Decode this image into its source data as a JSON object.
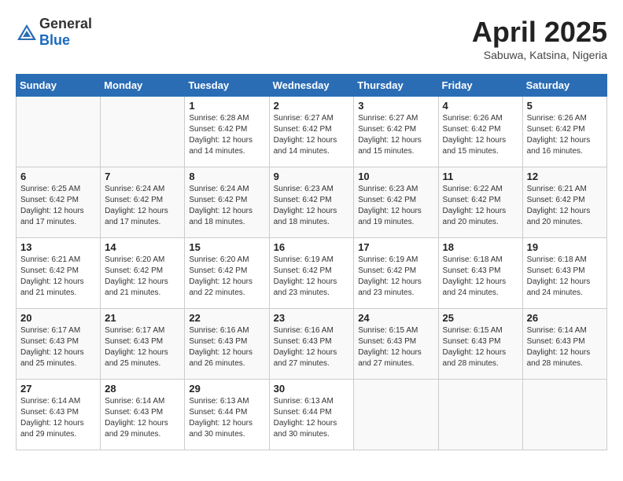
{
  "header": {
    "logo_general": "General",
    "logo_blue": "Blue",
    "month_title": "April 2025",
    "subtitle": "Sabuwa, Katsina, Nigeria"
  },
  "days_of_week": [
    "Sunday",
    "Monday",
    "Tuesday",
    "Wednesday",
    "Thursday",
    "Friday",
    "Saturday"
  ],
  "weeks": [
    [
      {
        "day": "",
        "sunrise": "",
        "sunset": "",
        "daylight": ""
      },
      {
        "day": "",
        "sunrise": "",
        "sunset": "",
        "daylight": ""
      },
      {
        "day": "1",
        "sunrise": "Sunrise: 6:28 AM",
        "sunset": "Sunset: 6:42 PM",
        "daylight": "Daylight: 12 hours and 14 minutes."
      },
      {
        "day": "2",
        "sunrise": "Sunrise: 6:27 AM",
        "sunset": "Sunset: 6:42 PM",
        "daylight": "Daylight: 12 hours and 14 minutes."
      },
      {
        "day": "3",
        "sunrise": "Sunrise: 6:27 AM",
        "sunset": "Sunset: 6:42 PM",
        "daylight": "Daylight: 12 hours and 15 minutes."
      },
      {
        "day": "4",
        "sunrise": "Sunrise: 6:26 AM",
        "sunset": "Sunset: 6:42 PM",
        "daylight": "Daylight: 12 hours and 15 minutes."
      },
      {
        "day": "5",
        "sunrise": "Sunrise: 6:26 AM",
        "sunset": "Sunset: 6:42 PM",
        "daylight": "Daylight: 12 hours and 16 minutes."
      }
    ],
    [
      {
        "day": "6",
        "sunrise": "Sunrise: 6:25 AM",
        "sunset": "Sunset: 6:42 PM",
        "daylight": "Daylight: 12 hours and 17 minutes."
      },
      {
        "day": "7",
        "sunrise": "Sunrise: 6:24 AM",
        "sunset": "Sunset: 6:42 PM",
        "daylight": "Daylight: 12 hours and 17 minutes."
      },
      {
        "day": "8",
        "sunrise": "Sunrise: 6:24 AM",
        "sunset": "Sunset: 6:42 PM",
        "daylight": "Daylight: 12 hours and 18 minutes."
      },
      {
        "day": "9",
        "sunrise": "Sunrise: 6:23 AM",
        "sunset": "Sunset: 6:42 PM",
        "daylight": "Daylight: 12 hours and 18 minutes."
      },
      {
        "day": "10",
        "sunrise": "Sunrise: 6:23 AM",
        "sunset": "Sunset: 6:42 PM",
        "daylight": "Daylight: 12 hours and 19 minutes."
      },
      {
        "day": "11",
        "sunrise": "Sunrise: 6:22 AM",
        "sunset": "Sunset: 6:42 PM",
        "daylight": "Daylight: 12 hours and 20 minutes."
      },
      {
        "day": "12",
        "sunrise": "Sunrise: 6:21 AM",
        "sunset": "Sunset: 6:42 PM",
        "daylight": "Daylight: 12 hours and 20 minutes."
      }
    ],
    [
      {
        "day": "13",
        "sunrise": "Sunrise: 6:21 AM",
        "sunset": "Sunset: 6:42 PM",
        "daylight": "Daylight: 12 hours and 21 minutes."
      },
      {
        "day": "14",
        "sunrise": "Sunrise: 6:20 AM",
        "sunset": "Sunset: 6:42 PM",
        "daylight": "Daylight: 12 hours and 21 minutes."
      },
      {
        "day": "15",
        "sunrise": "Sunrise: 6:20 AM",
        "sunset": "Sunset: 6:42 PM",
        "daylight": "Daylight: 12 hours and 22 minutes."
      },
      {
        "day": "16",
        "sunrise": "Sunrise: 6:19 AM",
        "sunset": "Sunset: 6:42 PM",
        "daylight": "Daylight: 12 hours and 23 minutes."
      },
      {
        "day": "17",
        "sunrise": "Sunrise: 6:19 AM",
        "sunset": "Sunset: 6:42 PM",
        "daylight": "Daylight: 12 hours and 23 minutes."
      },
      {
        "day": "18",
        "sunrise": "Sunrise: 6:18 AM",
        "sunset": "Sunset: 6:43 PM",
        "daylight": "Daylight: 12 hours and 24 minutes."
      },
      {
        "day": "19",
        "sunrise": "Sunrise: 6:18 AM",
        "sunset": "Sunset: 6:43 PM",
        "daylight": "Daylight: 12 hours and 24 minutes."
      }
    ],
    [
      {
        "day": "20",
        "sunrise": "Sunrise: 6:17 AM",
        "sunset": "Sunset: 6:43 PM",
        "daylight": "Daylight: 12 hours and 25 minutes."
      },
      {
        "day": "21",
        "sunrise": "Sunrise: 6:17 AM",
        "sunset": "Sunset: 6:43 PM",
        "daylight": "Daylight: 12 hours and 25 minutes."
      },
      {
        "day": "22",
        "sunrise": "Sunrise: 6:16 AM",
        "sunset": "Sunset: 6:43 PM",
        "daylight": "Daylight: 12 hours and 26 minutes."
      },
      {
        "day": "23",
        "sunrise": "Sunrise: 6:16 AM",
        "sunset": "Sunset: 6:43 PM",
        "daylight": "Daylight: 12 hours and 27 minutes."
      },
      {
        "day": "24",
        "sunrise": "Sunrise: 6:15 AM",
        "sunset": "Sunset: 6:43 PM",
        "daylight": "Daylight: 12 hours and 27 minutes."
      },
      {
        "day": "25",
        "sunrise": "Sunrise: 6:15 AM",
        "sunset": "Sunset: 6:43 PM",
        "daylight": "Daylight: 12 hours and 28 minutes."
      },
      {
        "day": "26",
        "sunrise": "Sunrise: 6:14 AM",
        "sunset": "Sunset: 6:43 PM",
        "daylight": "Daylight: 12 hours and 28 minutes."
      }
    ],
    [
      {
        "day": "27",
        "sunrise": "Sunrise: 6:14 AM",
        "sunset": "Sunset: 6:43 PM",
        "daylight": "Daylight: 12 hours and 29 minutes."
      },
      {
        "day": "28",
        "sunrise": "Sunrise: 6:14 AM",
        "sunset": "Sunset: 6:43 PM",
        "daylight": "Daylight: 12 hours and 29 minutes."
      },
      {
        "day": "29",
        "sunrise": "Sunrise: 6:13 AM",
        "sunset": "Sunset: 6:44 PM",
        "daylight": "Daylight: 12 hours and 30 minutes."
      },
      {
        "day": "30",
        "sunrise": "Sunrise: 6:13 AM",
        "sunset": "Sunset: 6:44 PM",
        "daylight": "Daylight: 12 hours and 30 minutes."
      },
      {
        "day": "",
        "sunrise": "",
        "sunset": "",
        "daylight": ""
      },
      {
        "day": "",
        "sunrise": "",
        "sunset": "",
        "daylight": ""
      },
      {
        "day": "",
        "sunrise": "",
        "sunset": "",
        "daylight": ""
      }
    ]
  ]
}
